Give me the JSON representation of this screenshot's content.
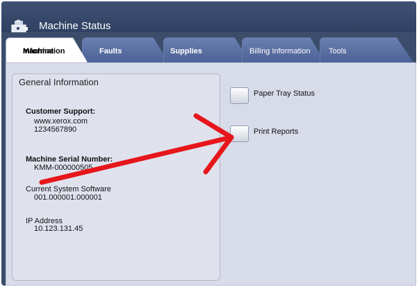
{
  "window": {
    "title": "Machine Status",
    "icon": "machine-icon"
  },
  "tabs": [
    {
      "label_line1": "Machine",
      "label_line2": "Information",
      "active": true
    },
    {
      "label": "Faults"
    },
    {
      "label": "Supplies"
    },
    {
      "label": "Billing Information"
    },
    {
      "label": "Tools"
    }
  ],
  "general": {
    "title": "General Information",
    "support_label": "Customer Support:",
    "support_url": "www.xerox.com",
    "support_phone": "1234567890",
    "serial_label": "Machine Serial Number:",
    "serial_value": "KMM-000000505",
    "software_label": "Current System Software",
    "software_value": "001.000001.000001",
    "ip_label": "IP Address",
    "ip_value": "10.123.131.45"
  },
  "actions": {
    "paper_tray": "Paper Tray Status",
    "print_reports": "Print Reports"
  },
  "colors": {
    "titlebar": "#3b4d6b",
    "tab": "#5a6fa3",
    "panel": "#d8dce9",
    "annotation": "#e6161b"
  }
}
